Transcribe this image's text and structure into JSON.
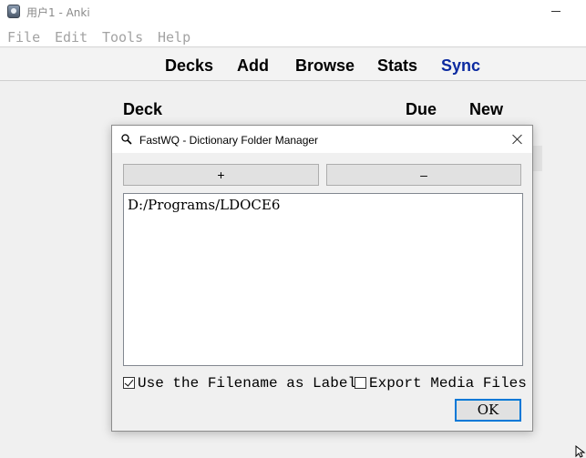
{
  "window": {
    "title": "用户1 - Anki"
  },
  "menu": {
    "items": [
      "File",
      "Edit",
      "Tools",
      "Help"
    ]
  },
  "toolbar": {
    "decks": "Decks",
    "add": "Add",
    "browse": "Browse",
    "stats": "Stats",
    "sync": "Sync"
  },
  "deck_table": {
    "columns": [
      "Deck",
      "Due",
      "New"
    ]
  },
  "dialog": {
    "title": "FastWQ - Dictionary Folder Manager",
    "add_label": "+",
    "remove_label": "–",
    "folders": [
      "D:/Programs/LDOCE6"
    ],
    "options": {
      "use_filename_label": "Use the Filename as Label",
      "use_filename_checked": true,
      "export_media_label": "Export Media Files",
      "export_media_checked": false
    },
    "ok_label": "OK"
  },
  "colors": {
    "accent": "#0078d7",
    "sync_link": "#0b2aa0"
  }
}
